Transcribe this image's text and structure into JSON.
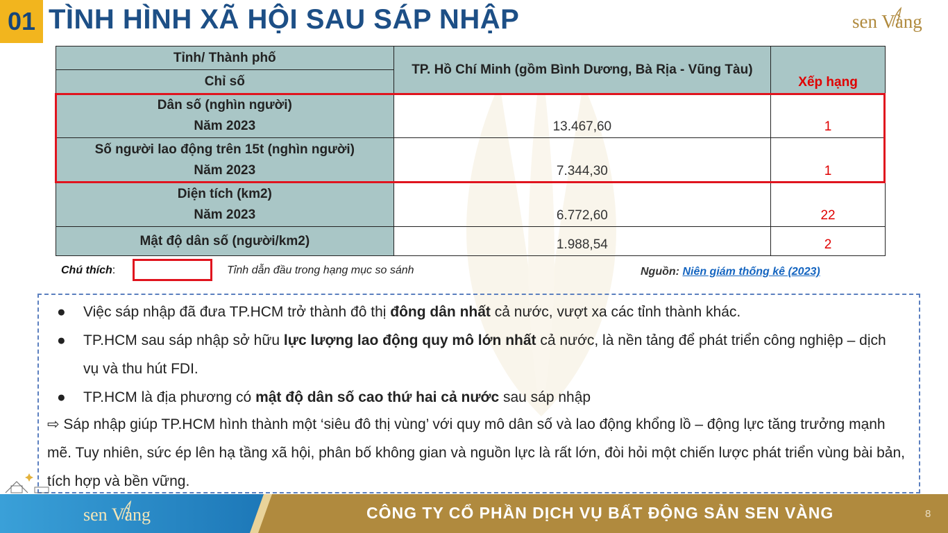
{
  "header": {
    "section_number": "01",
    "title": "TÌNH HÌNH XÃ HỘI SAU SÁP NHẬP",
    "logo_text": "sen Vàng"
  },
  "table": {
    "header_row1_label": "Tỉnh/ Thành phố",
    "header_row2_label": "Chỉ số",
    "header_region": "TP. Hồ Chí Minh (gồm Bình Dương, Bà Rịa - Vũng Tàu)",
    "header_rank": "Xếp hạng",
    "rows": [
      {
        "label": "Dân số (nghìn người)",
        "year": "Năm 2023",
        "value": "13.467,60",
        "rank": "1"
      },
      {
        "label": "Số người lao động trên 15t (nghìn người)",
        "year": "Năm 2023",
        "value": "7.344,30",
        "rank": "1"
      },
      {
        "label": "Diện tích (km2)",
        "year": "Năm 2023",
        "value": "6.772,60",
        "rank": "22"
      },
      {
        "label": "Mật độ dân số (người/km2)",
        "value": "1.988,54",
        "rank": "2"
      }
    ]
  },
  "legend": {
    "label": "Chú thích",
    "colon": ":",
    "text": "Tỉnh dẫn đầu trong hạng mục so sánh"
  },
  "source": {
    "label": "Nguồn:",
    "link_text": "Niên giám thống kê (2023)"
  },
  "notes": {
    "bullet_symbol": "●",
    "bullets": [
      {
        "pre": "Việc sáp nhập đã đưa TP.HCM trở thành đô thị ",
        "bold": "đông dân nhất",
        "post": " cả nước, vượt xa các tỉnh thành khác."
      },
      {
        "pre": "TP.HCM sau sáp nhập sở hữu ",
        "bold": "lực lượng lao động quy mô lớn nhất",
        "post": " cả nước, là nền tảng để phát triển công nghiệp – dịch vụ và thu hút FDI."
      },
      {
        "pre": "TP.HCM là địa phương có ",
        "bold": "mật độ dân số cao thứ hai cả nước",
        "post": " sau sáp nhập"
      }
    ],
    "conclusion": "⇨ Sáp nhập giúp TP.HCM hình thành một ‘siêu đô thị vùng’ với quy mô dân số và lao động khổng lồ – động lực tăng trưởng mạnh mẽ. Tuy nhiên, sức ép lên hạ tầng xã hội, phân bố không gian và nguồn lực là rất lớn, đòi hỏi một chiến lược phát triển vùng bài bản, tích hợp và bền vững."
  },
  "footer": {
    "company": "CÔNG TY CỔ PHẦN DỊCH VỤ BẤT ĐỘNG SẢN SEN VÀNG",
    "page_number": "8",
    "logo_text": "sen Vàng"
  },
  "colors": {
    "title_blue": "#1d4f86",
    "accent_gold": "#f2b51e",
    "table_header": "#a9c6c6",
    "highlight_red": "#e0141e",
    "footer_gold": "#b08a3e",
    "footer_blue": "#2b8fc9"
  }
}
